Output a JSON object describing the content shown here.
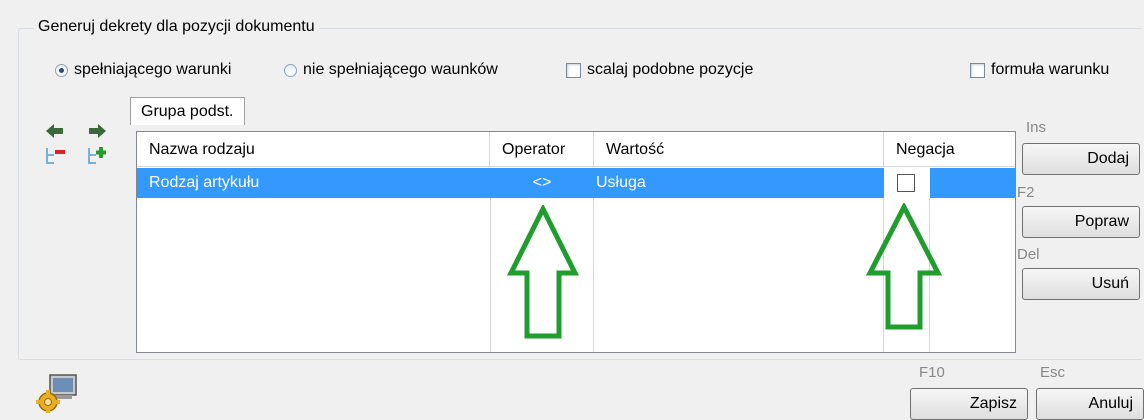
{
  "group": {
    "title": "Generuj dekrety dla pozycji dokumentu",
    "options": {
      "radio_match": "spełniającego warunki",
      "radio_nomatch": "nie spełniającego waunków",
      "merge_similar": "scalaj podobne pozycje",
      "condition_formula": "formuła warunku"
    }
  },
  "tabs": [
    "Grupa podst."
  ],
  "grid": {
    "columns": [
      "Nazwa rodzaju",
      "Operator",
      "Wartość",
      "Negacja"
    ],
    "rows": [
      {
        "name": "Rodzaj artykułu",
        "operator": "<>",
        "value": "Usługa",
        "negation": false
      }
    ]
  },
  "buttons": {
    "add": {
      "key": "Ins",
      "label": "Dodaj"
    },
    "edit": {
      "key": "F2",
      "label": "Popraw"
    },
    "delete": {
      "key": "Del",
      "label": "Usuń"
    },
    "save": {
      "key": "F10",
      "label": "Zapisz"
    },
    "cancel": {
      "key": "Esc",
      "label": "Anuluj"
    }
  },
  "icons": {
    "left_arrow": "arrow-left-icon",
    "right_arrow": "arrow-right-icon",
    "remove_node": "tree-remove-icon",
    "add_node": "tree-add-icon",
    "settings": "gear-computer-icon"
  },
  "colors": {
    "selection": "#3399ff",
    "annotation_arrow": "#1f9e2e"
  }
}
